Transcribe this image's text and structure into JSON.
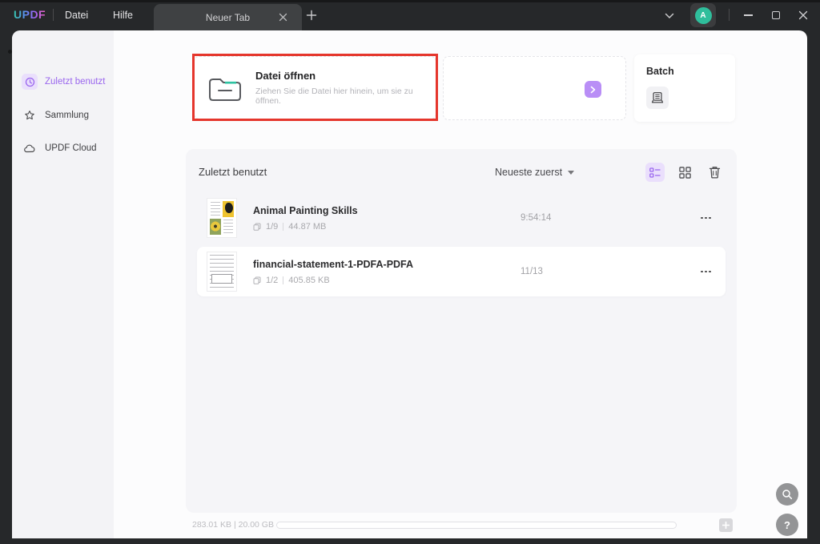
{
  "titlebar": {
    "logo": "UPDF",
    "menus": [
      {
        "label": "Datei"
      },
      {
        "label": "Hilfe"
      }
    ],
    "tab": {
      "label": "Neuer Tab"
    },
    "avatar_initial": "A"
  },
  "sidebar": {
    "items": [
      {
        "label": "Zuletzt benutzt",
        "icon": "clock-icon",
        "active": true
      },
      {
        "label": "Sammlung",
        "icon": "star-icon",
        "active": false
      },
      {
        "label": "UPDF Cloud",
        "icon": "cloud-icon",
        "active": false
      }
    ]
  },
  "cards": {
    "open": {
      "title": "Datei öffnen",
      "subtitle": "Ziehen Sie die Datei hier hinein, um sie zu öffnen."
    },
    "batch": {
      "title": "Batch"
    }
  },
  "recent": {
    "title": "Zuletzt benutzt",
    "sort_label": "Neueste zuerst",
    "files": [
      {
        "name": "Animal Painting Skills",
        "pages": "1/9",
        "size": "44.87 MB",
        "time": "9:54:14"
      },
      {
        "name": "financial-statement-1-PDFA-PDFA",
        "pages": "1/2",
        "size": "405.85 KB",
        "time": "11/13"
      }
    ]
  },
  "storage": {
    "usage": "283.01 KB | 20.00 GB"
  },
  "fab": {
    "help_glyph": "?"
  },
  "colors": {
    "accent_purple": "#9A66EE",
    "annotation_red": "#E5362C",
    "avatar_green": "#2FBE9C"
  }
}
